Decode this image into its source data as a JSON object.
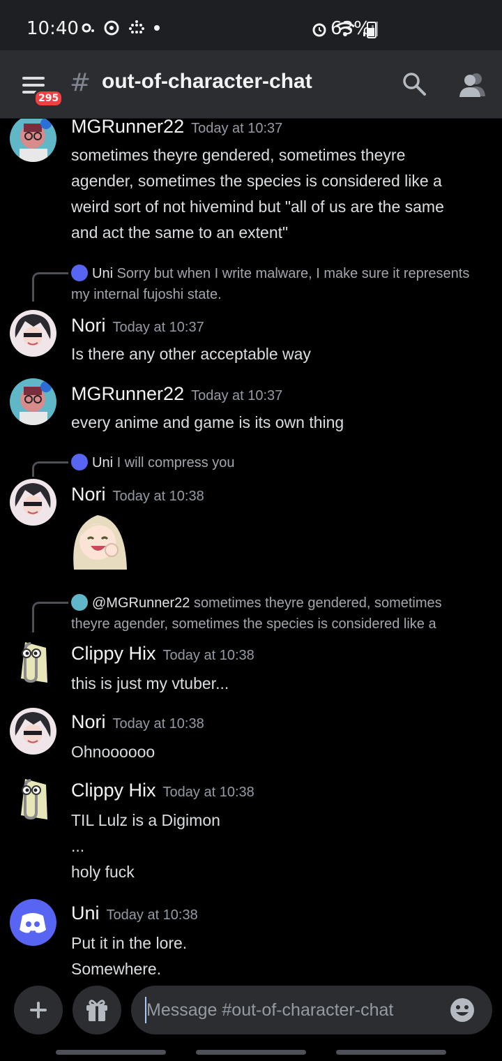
{
  "status_bar": {
    "time": "10:40",
    "battery": "63%"
  },
  "header": {
    "notification_badge": "295",
    "hash": "#",
    "channel_name": "out-of-character-chat"
  },
  "messages": [
    {
      "author": "MGRunner22",
      "timestamp": "Today at 10:37",
      "lines": [
        "sometimes theyre gendered, sometimes theyre",
        "agender, sometimes the species is considered like a",
        "weird sort of not hivemind but \"all of us are the same",
        "and act the same to an extent\""
      ]
    },
    {
      "reply": {
        "author": "Uni",
        "text": "Sorry but when I write malware, I make sure it represents my internal fujoshi state."
      },
      "author": "Nori",
      "timestamp": "Today at 10:37",
      "lines": [
        "Is there any other acceptable way"
      ]
    },
    {
      "author": "MGRunner22",
      "timestamp": "Today at 10:37",
      "lines": [
        "every anime and game is its own thing"
      ]
    },
    {
      "reply": {
        "author": "Uni",
        "text": "I will compress you"
      },
      "author": "Nori",
      "timestamp": "Today at 10:38",
      "sticker": "laughing-anime-girl-sticker"
    },
    {
      "reply": {
        "author": "@MGRunner22",
        "text": "sometimes theyre gendered, sometimes theyre agender, sometimes the species is considered like a"
      },
      "author": "Clippy Hix",
      "timestamp": "Today at 10:38",
      "lines": [
        "this is just my vtuber..."
      ]
    },
    {
      "author": "Nori",
      "timestamp": "Today at 10:38",
      "lines": [
        "Ohnoooooo"
      ]
    },
    {
      "author": "Clippy Hix",
      "timestamp": "Today at 10:38",
      "lines": [
        "TIL Lulz is a Digimon",
        "...",
        "holy fuck"
      ]
    },
    {
      "author": "Uni",
      "timestamp": "Today at 10:38",
      "lines": [
        "Put it in the lore.",
        "Somewhere."
      ]
    }
  ],
  "composer": {
    "placeholder": "Message #out-of-character-chat"
  },
  "colors": {
    "blurple": "#5865f2",
    "badge_red": "#f23f42",
    "header_bg": "#2b2d31"
  }
}
